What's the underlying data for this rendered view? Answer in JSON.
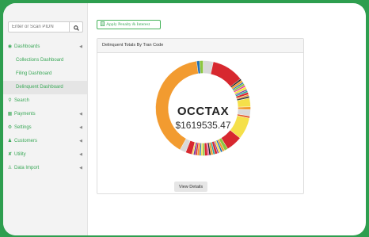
{
  "search": {
    "placeholder": "Enter or Scan PIDN"
  },
  "sidebar": {
    "items": [
      {
        "label": "Dashboards",
        "icon": "gauge-icon"
      },
      {
        "label": "Collections Dashboard"
      },
      {
        "label": "Filing Dashboard"
      },
      {
        "label": "Delinquent Dashboard"
      },
      {
        "label": "Search",
        "icon": "search-icon"
      },
      {
        "label": "Payments",
        "icon": "bank-icon"
      },
      {
        "label": "Settings",
        "icon": "gear-icon"
      },
      {
        "label": "Customers",
        "icon": "users-icon"
      },
      {
        "label": "Utility",
        "icon": "wrench-icon"
      },
      {
        "label": "Data Import",
        "icon": "user-icon"
      }
    ]
  },
  "toolbar": {
    "apply_label": "Apply Penalty & Interest"
  },
  "panel": {
    "title": "Delinquent Totals By Tran Code",
    "center_label": "OCCTAX",
    "center_value": "$1619535.47",
    "details_label": "View Details"
  },
  "colors": {
    "brand_green": "#2e9e4f",
    "link_green": "#3aa857",
    "highlight_orange": "#f29b30"
  },
  "chart_data": {
    "type": "pie",
    "title": "Delinquent Totals By Tran Code",
    "highlight": {
      "label": "OCCTAX",
      "value": 1619535.47
    },
    "slice_shares": [
      0.035,
      0.11,
      0.006,
      0.008,
      0.005,
      0.007,
      0.006,
      0.009,
      0.005,
      0.006,
      0.008,
      0.005,
      0.007,
      0.03,
      0.01,
      0.022,
      0.007,
      0.075,
      0.055,
      0.012,
      0.008,
      0.006,
      0.007,
      0.005,
      0.009,
      0.006,
      0.008,
      0.006,
      0.005,
      0.01,
      0.007,
      0.006,
      0.005,
      0.008,
      0.006,
      0.007,
      0.005,
      0.022,
      0.021,
      0.4,
      0.01,
      0.012
    ],
    "slice_colors": [
      "#d9d9d9",
      "#d7282f",
      "#2a2a2a",
      "#f29b30",
      "#1f6fb5",
      "#8cc63f",
      "#e84393",
      "#f5e04a",
      "#7b3fa0",
      "#26a69a",
      "#d7282f",
      "#f29b30",
      "#444444",
      "#f5e04a",
      "#f29b30",
      "#d9d9d9",
      "#e05a2b",
      "#f5e04a",
      "#d7282f",
      "#8cc63f",
      "#f29b30",
      "#1f6fb5",
      "#f5e04a",
      "#7b3fa0",
      "#d7282f",
      "#26a69a",
      "#f29b30",
      "#2a2a2a",
      "#e84393",
      "#d7282f",
      "#8cc63f",
      "#f5e04a",
      "#1f6fb5",
      "#f29b30",
      "#d7282f",
      "#7b3fa0",
      "#f5e04a",
      "#d7282f",
      "#d9d9d9",
      "#f29b30",
      "#1f6fb5",
      "#8cc63f"
    ]
  }
}
